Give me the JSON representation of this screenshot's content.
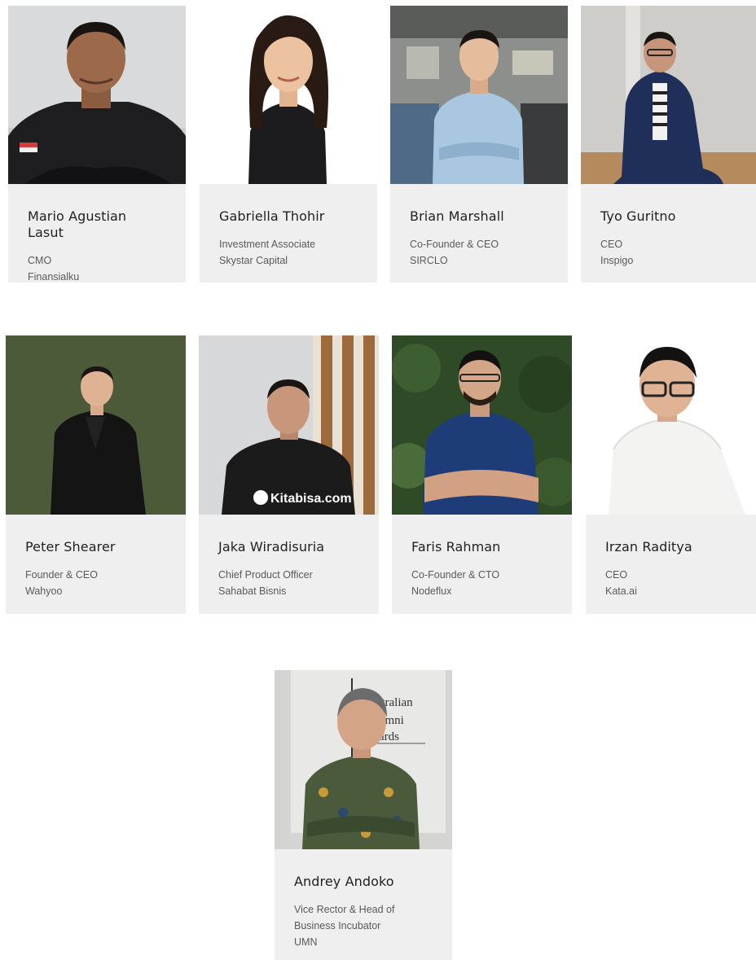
{
  "people": [
    {
      "name": "Mario Agustian Lasut",
      "lines": [
        "CMO",
        "Finansialku"
      ]
    },
    {
      "name": "Gabriella Thohir",
      "lines": [
        "Investment Associate",
        "Skystar Capital"
      ]
    },
    {
      "name": "Brian Marshall",
      "lines": [
        "Co-Founder & CEO",
        "SIRCLO"
      ]
    },
    {
      "name": "Tyo Guritno",
      "lines": [
        "CEO",
        "Inspigo"
      ]
    },
    {
      "name": "Peter Shearer",
      "lines": [
        "Founder & CEO",
        "Wahyoo"
      ]
    },
    {
      "name": "Jaka Wiradisuria",
      "lines": [
        "Chief Product Officer",
        "Sahabat Bisnis"
      ]
    },
    {
      "name": "Faris Rahman",
      "lines": [
        "Co-Founder & CTO",
        "Nodeflux"
      ]
    },
    {
      "name": "Irzan Raditya",
      "lines": [
        "CEO",
        "Kata.ai"
      ]
    },
    {
      "name": "Andrey Andoko",
      "lines": [
        "Vice Rector & Head of",
        "Business Incubator",
        "UMN"
      ]
    }
  ],
  "photo_text": {
    "shirt_kitabisa": "Kitabisa.com",
    "shirt_mario": "Finansialku",
    "banner": [
      "ustralian",
      "umni",
      "ards"
    ]
  },
  "colors": {
    "card_bg": "#efefef",
    "name_color": "#1f1f1f",
    "role_color": "#5a5a5a"
  }
}
